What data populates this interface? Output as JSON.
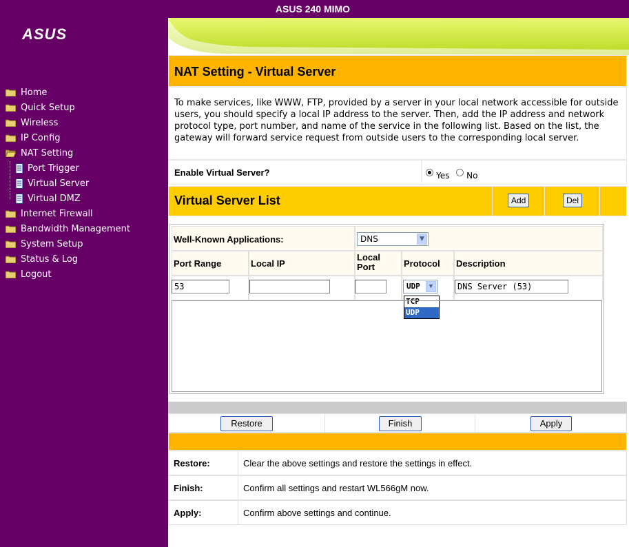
{
  "header": {
    "title": "ASUS 240 MIMO",
    "logo_text": "ASUS"
  },
  "sidebar": {
    "items": [
      {
        "label": "Home",
        "icon": "folder-icon"
      },
      {
        "label": "Quick Setup",
        "icon": "folder-icon"
      },
      {
        "label": "Wireless",
        "icon": "folder-icon"
      },
      {
        "label": "IP Config",
        "icon": "folder-icon"
      },
      {
        "label": "NAT Setting",
        "icon": "open-folder-icon"
      },
      {
        "label": "Port Trigger",
        "icon": "document-icon"
      },
      {
        "label": "Virtual Server",
        "icon": "document-icon"
      },
      {
        "label": "Virtual DMZ",
        "icon": "document-icon"
      },
      {
        "label": "Internet Firewall",
        "icon": "folder-icon"
      },
      {
        "label": "Bandwidth Management",
        "icon": "folder-icon"
      },
      {
        "label": "System Setup",
        "icon": "folder-icon"
      },
      {
        "label": "Status & Log",
        "icon": "folder-icon"
      },
      {
        "label": "Logout",
        "icon": "folder-icon"
      }
    ]
  },
  "page": {
    "title": "NAT Setting - Virtual Server",
    "description": "To make services, like WWW, FTP, provided by a server in your local network accessible for outside users, you should specify a local IP address to the server. Then, add the IP address and network protocol type, port number, and name of the service in the following list. Based on the list, the gateway will forward service request from outside users to the corresponding local server.",
    "enable_question": "Enable Virtual Server?",
    "yes_label": "Yes",
    "no_label": "No",
    "enabled": "Yes"
  },
  "list": {
    "title": "Virtual Server List",
    "add_label": "Add",
    "del_label": "Del",
    "well_known_label": "Well-Known Applications:",
    "well_known_value": "DNS",
    "columns": [
      "Port Range",
      "Local IP",
      "Local Port",
      "Protocol",
      "Description"
    ],
    "port_range": "53",
    "local_ip": "",
    "local_port": "",
    "protocol": "UDP",
    "protocol_options": [
      "TCP",
      "UDP"
    ],
    "description": "DNS Server (53)"
  },
  "actions": {
    "restore": "Restore",
    "finish": "Finish",
    "apply": "Apply"
  },
  "help": [
    {
      "key": "Restore:",
      "text": "Clear the above settings and restore the settings in effect."
    },
    {
      "key": "Finish:",
      "text": "Confirm all settings and restart WL566gM now."
    },
    {
      "key": "Apply:",
      "text": "Confirm above settings and continue."
    }
  ],
  "colors": {
    "sidebar": "#660066",
    "header_orange": "#ffb400",
    "list_yellow": "#ffcc00",
    "banner_green": "#ccee44"
  }
}
